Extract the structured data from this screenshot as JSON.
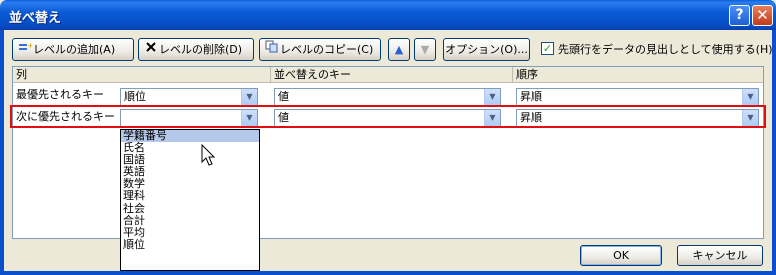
{
  "window": {
    "title": "並べ替え",
    "help_label": "?",
    "close_label": "✕"
  },
  "toolbar": {
    "add_label": "レベルの追加(A)",
    "delete_label": "レベルの削除(D)",
    "copy_label": "レベルのコピー(C)",
    "up_label": "▲",
    "down_label": "▼",
    "options_label": "オプション(O)...",
    "header_checkbox_label": "先頭行をデータの見出しとして使用する(H)",
    "header_checkbox_checked": true
  },
  "grid": {
    "headers": {
      "column": "列",
      "sort_on": "並べ替えのキー",
      "order": "順序"
    },
    "rows": [
      {
        "label": "最優先されるキー",
        "column": "順位",
        "sort_on": "値",
        "order": "昇順"
      },
      {
        "label": "次に優先されるキー",
        "column": "",
        "sort_on": "値",
        "order": "昇順"
      }
    ]
  },
  "dropdown_options": [
    "学籍番号",
    "氏名",
    "国語",
    "英語",
    "数学",
    "理科",
    "社会",
    "合計",
    "平均",
    "順位"
  ],
  "dropdown_highlighted_index": 0,
  "footer": {
    "ok_label": "OK",
    "cancel_label": "キャンセル"
  },
  "colors": {
    "titlebar": "#0a5fd8",
    "selection_outline": "#e01010",
    "dropdown_highlight": "#b6c8e9",
    "dialog_bg": "#ece9d8"
  }
}
